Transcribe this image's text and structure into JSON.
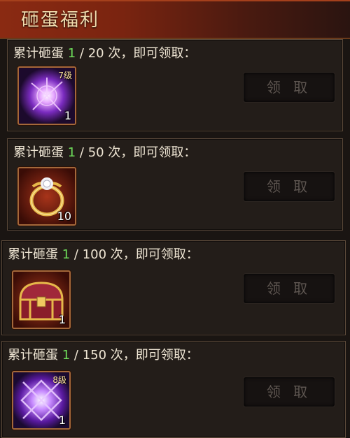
{
  "header": {
    "title": "砸蛋福利"
  },
  "rewards": [
    {
      "prefix": "累计砸蛋 ",
      "current": "1",
      "suffix": " / 20 次，即可领取：",
      "item": {
        "quantity": "1",
        "level": "7级",
        "icon": "purple-orb-icon"
      },
      "button": "领 取"
    },
    {
      "prefix": "累计砸蛋 ",
      "current": "1",
      "suffix": " / 50 次，即可领取：",
      "item": {
        "quantity": "10",
        "level": "",
        "icon": "gold-ring-icon"
      },
      "button": "领 取"
    },
    {
      "prefix": "累计砸蛋 ",
      "current": "1",
      "suffix": " / 100 次，即可领取：",
      "item": {
        "quantity": "1",
        "level": "",
        "icon": "treasure-chest-icon"
      },
      "button": "领 取"
    },
    {
      "prefix": "累计砸蛋 ",
      "current": "1",
      "suffix": " / 150 次，即可领取：",
      "item": {
        "quantity": "1",
        "level": "8级",
        "icon": "purple-crystal-icon"
      },
      "button": "领 取"
    }
  ]
}
